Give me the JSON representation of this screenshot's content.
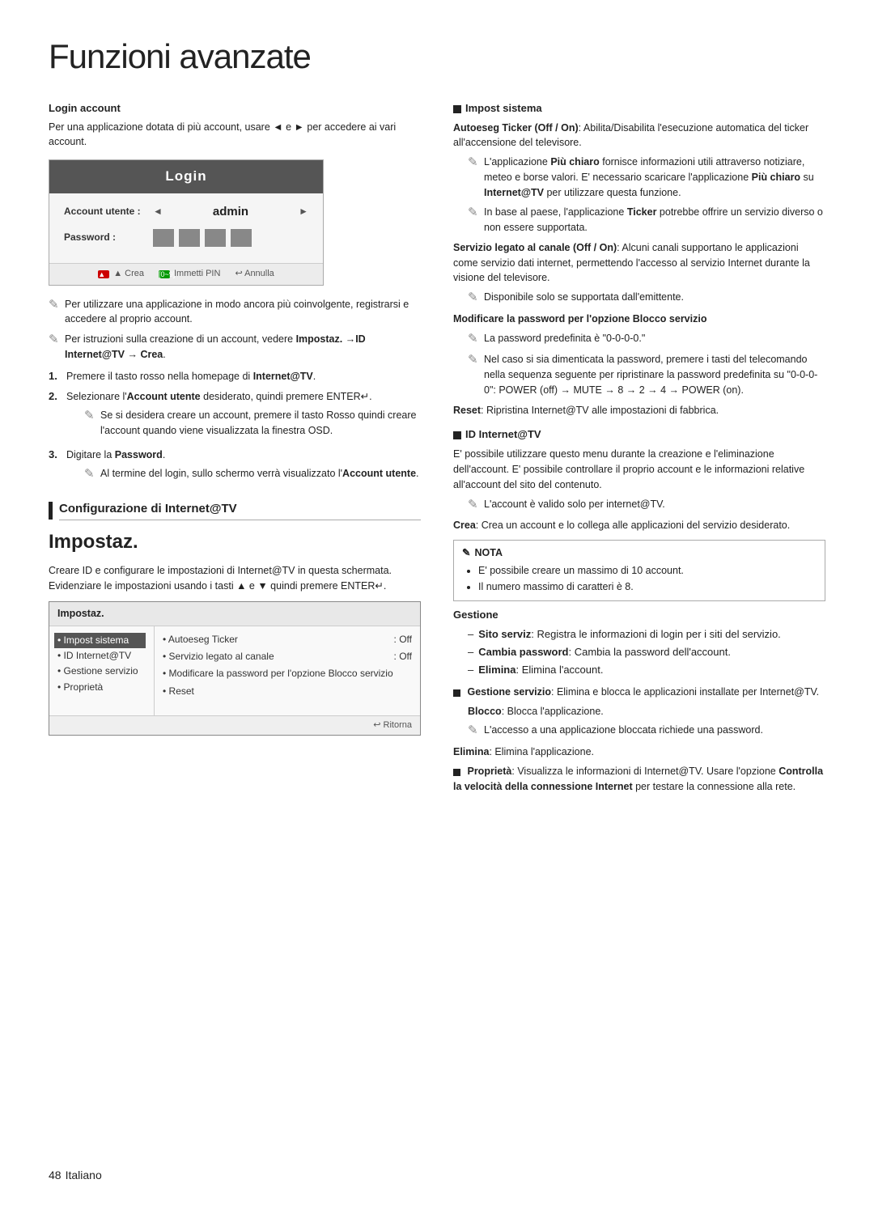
{
  "page": {
    "title": "Funzioni avanzate",
    "page_number": "48",
    "language": "Italiano"
  },
  "left": {
    "login_account": {
      "heading": "Login account",
      "body": "Per una applicazione dotata di più account, usare ◄ e ► per accedere ai vari account.",
      "login_box": {
        "title": "Login",
        "field1_label": "Account utente :",
        "field1_value": "admin",
        "field2_label": "Password :",
        "footer_red_label": "▲ Crea",
        "footer_green_label": "[0~9] Immetti PIN",
        "footer_return_label": "↩ Annulla"
      },
      "note1": "Per utilizzare una applicazione in modo ancora più coinvolgente, registrarsi e accedere al proprio account.",
      "note2_prefix": "Per istruzioni sulla creazione di un account, vedere",
      "note2_bold": "Impostaz. →ID Internet@TV → Crea",
      "note2_suffix": ".",
      "steps": [
        {
          "num": "1.",
          "text": "Premere il tasto rosso nella homepage di",
          "bold": "Internet@TV",
          "suffix": "."
        },
        {
          "num": "2.",
          "text": "Selezionare l'",
          "bold": "Account utente",
          "suffix": " desiderato, quindi premere ENTER",
          "sub": "Se si desidera creare un account, premere il tasto Rosso quindi creare l'account quando viene visualizzata la finestra OSD."
        },
        {
          "num": "3.",
          "text": "Digitare la",
          "bold": "Password",
          "suffix": ".",
          "sub": "Al termine del login, sullo schermo verrà visualizzato l'Account utente."
        }
      ]
    },
    "configurazione": {
      "heading": "Configurazione di Internet@TV"
    },
    "impostaz": {
      "title": "Impostaz.",
      "body": "Creare ID e configurare le impostazioni di Internet@TV in questa schermata. Evidenziare le impostazioni usando i tasti ▲ e ▼ quindi premere ENTER",
      "box": {
        "title": "Impostaz.",
        "menu_items": [
          {
            "label": "• Impost sistema",
            "selected": true
          },
          {
            "label": "• ID Internet@TV"
          },
          {
            "label": "• Gestione servizio"
          },
          {
            "label": "• Proprietà"
          }
        ],
        "right_items": [
          {
            "label": "• Autoeseg Ticker",
            "value": ": Off"
          },
          {
            "label": "• Servizio legato al canale",
            "value": ": Off"
          },
          {
            "label": "• Modificare la password per l'opzione Blocco servizio"
          },
          {
            "label": "• Reset"
          }
        ],
        "footer": "↩ Ritorna"
      }
    }
  },
  "right": {
    "impost_sistema": {
      "heading": "Impost sistema",
      "autoeseg": {
        "label_bold": "Autoeseg Ticker (Off / On)",
        "label": ": Abilita/Disabilita l'esecuzione automatica del ticker all'accensione del televisore.",
        "note1_bold": "Più chiaro",
        "note1": "fornisce informazioni utili attraverso notiziare, meteo e borse valori. E' necessario scaricare l'applicazione",
        "note1_bold2": "Più chiaro",
        "note1_suffix": "su",
        "note1_bold3": "Internet@TV",
        "note1_suffix2": "per utilizzare questa funzione.",
        "note2": "In base al paese, l'applicazione",
        "note2_bold": "Ticker",
        "note2_suffix": "potrebbe offrire un servizio diverso o non essere supportata."
      },
      "servizio": {
        "label_bold": "Servizio legato al canale (Off / On)",
        "label": ": Alcuni canali supportano le applicazioni come servizio dati internet, permettendo l'accesso al servizio Internet durante la visione del televisore.",
        "note": "Disponibile solo se supportata dall'emittente."
      },
      "blocco": {
        "heading": "Modificare la password per l'opzione Blocco servizio",
        "note1": "La password predefinita è \"0-0-0-0.\"",
        "note2": "Nel caso si sia dimenticata la password, premere i tasti del telecomando nella sequenza seguente per ripristinare la password predefinita su \"0-0-0-0\": POWER (off) → MUTE → 8 → 2 → 4 → POWER (on)."
      },
      "reset": {
        "label_bold": "Reset",
        "label": ": Ripristina Internet@TV alle impostazioni di fabbrica."
      }
    },
    "id_internet": {
      "heading": "ID Internet@TV",
      "body": "E' possibile utilizzare questo menu durante la creazione e l'eliminazione dell'account. E' possibile controllare il proprio account e le informazioni relative all'account del sito del contenuto.",
      "note": "L'account è valido solo per internet@TV.",
      "crea_bold": "Crea",
      "crea": ": Crea un account e lo collega alle applicazioni del servizio desiderato.",
      "nota": {
        "title": "NOTA",
        "items": [
          "E' possibile creare un massimo di 10 account.",
          "Il numero massimo di caratteri è 8."
        ]
      },
      "gestione": {
        "heading": "Gestione",
        "items": [
          {
            "dash": "–",
            "bold": "Sito serviz",
            "text": ": Registra le informazioni di login per i siti del servizio."
          },
          {
            "dash": "–",
            "bold": "Cambia password",
            "text": ": Cambia la password dell'account."
          },
          {
            "dash": "–",
            "bold": "Elimina",
            "text": ": Elimina l'account."
          }
        ]
      },
      "gestione_servizio_bold": "Gestione servizio",
      "gestione_servizio": ": Elimina e blocca le applicazioni installate per Internet@TV.",
      "blocco": {
        "label_bold": "Blocco",
        "label": ": Blocca l'applicazione.",
        "note": "L'accesso a una applicazione bloccata richiede una password."
      },
      "elimina": {
        "label_bold": "Elimina",
        "label": ": Elimina l'applicazione."
      },
      "proprieta_bold": "Proprietà",
      "proprieta": ": Visualizza le informazioni di Internet@TV. Usare l'opzione",
      "proprieta_bold2": "Controlla la velocità della connessione Internet",
      "proprieta_suffix": "per testare la connessione alla rete."
    }
  },
  "icons": {
    "note_glyph": "🖊",
    "square": "■"
  }
}
